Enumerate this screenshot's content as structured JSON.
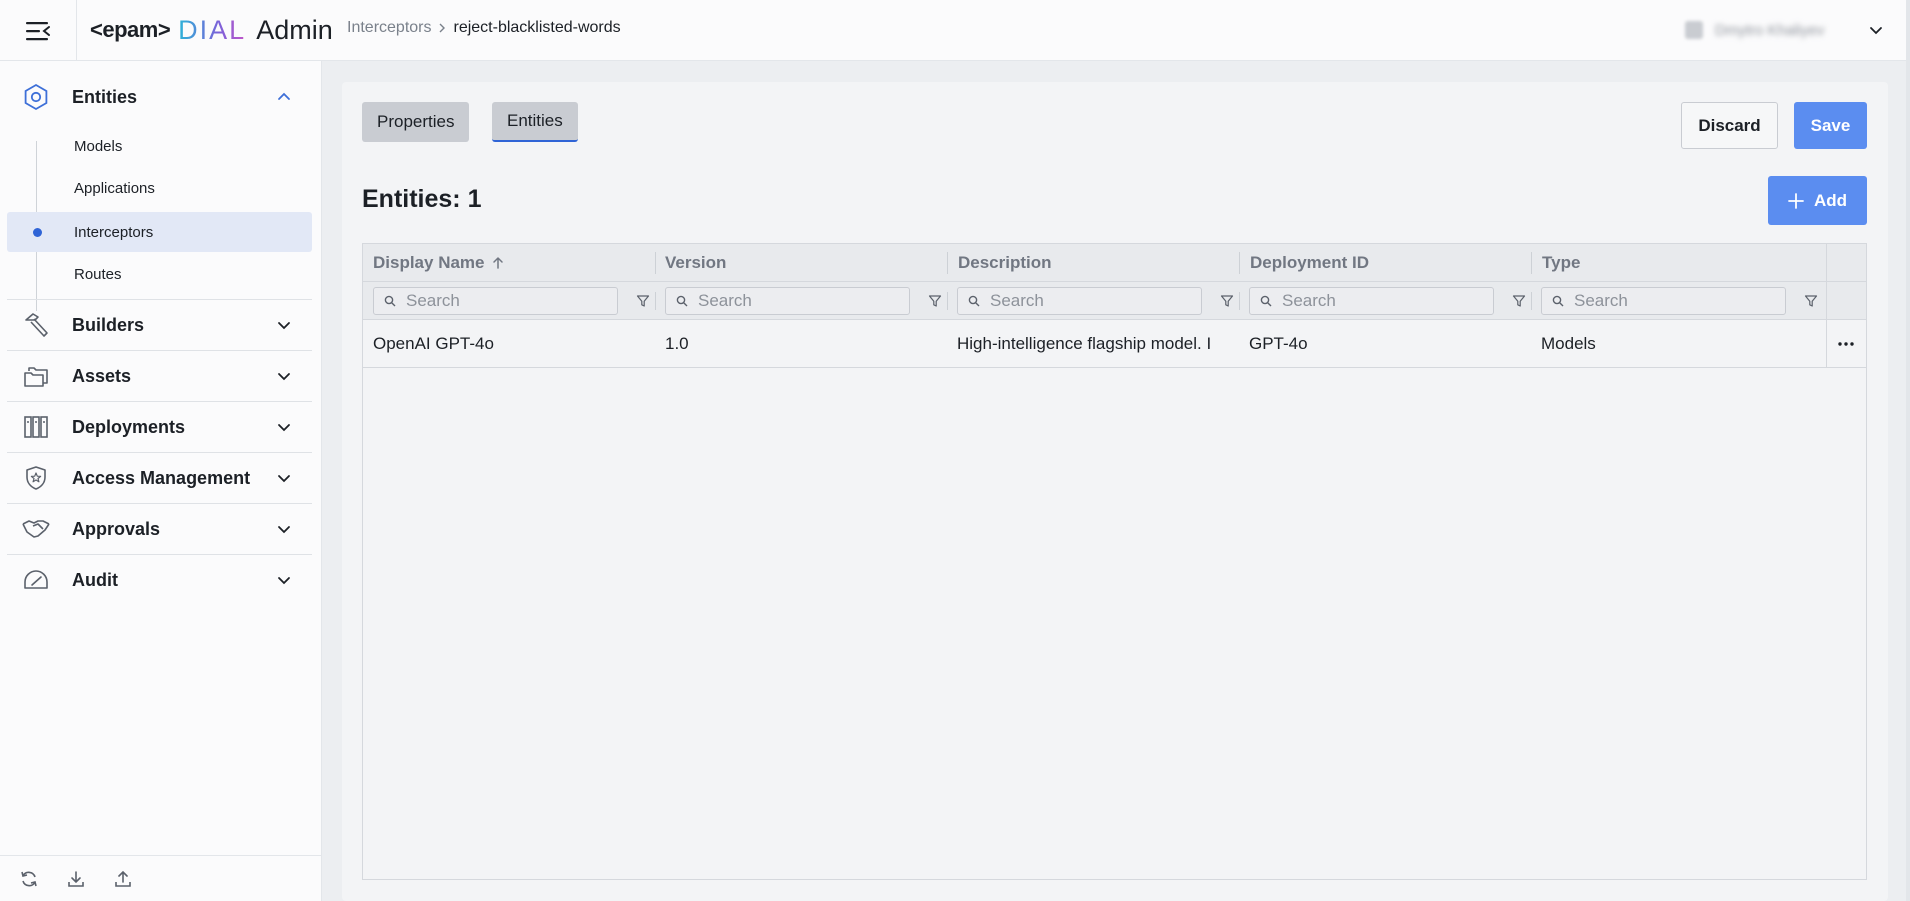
{
  "header": {
    "logo": {
      "brand": "<epam>",
      "product": "DIAL",
      "suffix": "Admin"
    },
    "breadcrumb": {
      "parent": "Interceptors",
      "current": "reject-blacklisted-words"
    },
    "user": {
      "name": "Dmytro Khaliyev"
    }
  },
  "sidebar": {
    "entities": {
      "label": "Entities",
      "expanded": true,
      "items": [
        {
          "label": "Models",
          "active": false
        },
        {
          "label": "Applications",
          "active": false
        },
        {
          "label": "Interceptors",
          "active": true
        },
        {
          "label": "Routes",
          "active": false
        }
      ]
    },
    "sections": [
      {
        "label": "Builders",
        "icon": "hammer-icon"
      },
      {
        "label": "Assets",
        "icon": "folder-icon"
      },
      {
        "label": "Deployments",
        "icon": "deployments-icon"
      },
      {
        "label": "Access Management",
        "icon": "shield-star-icon"
      },
      {
        "label": "Approvals",
        "icon": "handshake-icon"
      },
      {
        "label": "Audit",
        "icon": "gauge-icon"
      }
    ],
    "footer": [
      "refresh-icon",
      "download-icon",
      "upload-icon"
    ]
  },
  "main": {
    "tabs": [
      {
        "label": "Properties",
        "active": false
      },
      {
        "label": "Entities",
        "active": true
      }
    ],
    "actions": {
      "discard": "Discard",
      "save": "Save",
      "add": "Add"
    },
    "entities_title": "Entities: 1",
    "table": {
      "columns": [
        "Display Name",
        "Version",
        "Description",
        "Deployment ID",
        "Type"
      ],
      "sorted_column": "Display Name",
      "sort_direction": "ascending",
      "search_placeholder": "Search",
      "rows": [
        {
          "display_name": "OpenAI GPT-4o",
          "version": "1.0",
          "description": "High-intelligence flagship model. I",
          "deployment_id": "GPT-4o",
          "type": "Models"
        }
      ]
    }
  },
  "colors": {
    "accent": "#5b8df0",
    "active_indicator": "#2f64d6",
    "active_nav_bg": "#e2e8f6",
    "text": "#1c2026",
    "muted_text": "#717782"
  }
}
